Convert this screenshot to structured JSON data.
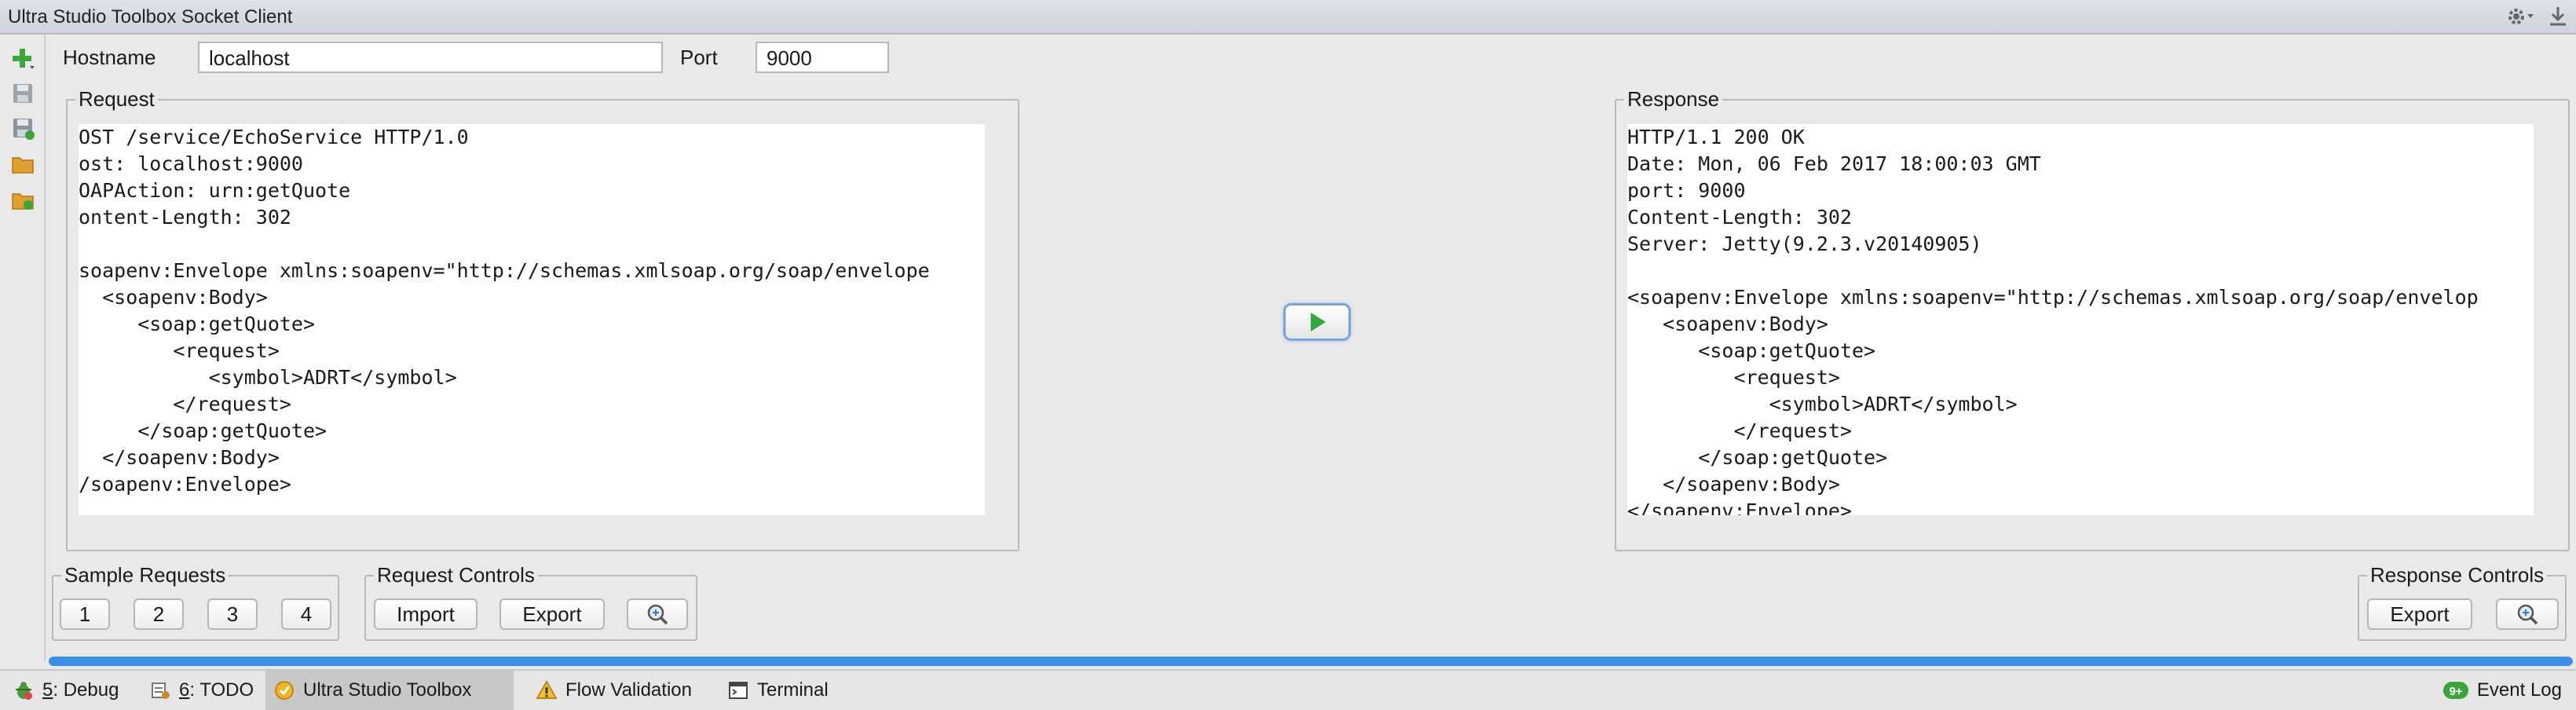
{
  "window": {
    "title": "Ultra Studio Toolbox Socket Client"
  },
  "toolbar_left": {
    "icons": [
      "add-icon",
      "save-icon",
      "save-as-icon",
      "open-folder-icon",
      "open-recent-icon"
    ]
  },
  "connection": {
    "hostname_label": "Hostname",
    "hostname_value": "localhost",
    "port_label": "Port",
    "port_value": "9000"
  },
  "request": {
    "legend": "Request",
    "lines": [
      "OST /service/EchoService HTTP/1.0",
      "ost: localhost:9000",
      "OAPAction: urn:getQuote",
      "ontent-Length: 302",
      "",
      "soapenv:Envelope xmlns:soapenv=\"http://schemas.xmlsoap.org/soap/envelope",
      "  <soapenv:Body>",
      "     <soap:getQuote>",
      "        <request>",
      "           <symbol>ADRT</symbol>",
      "        </request>",
      "     </soap:getQuote>",
      "  </soapenv:Body>",
      "/soapenv:Envelope>"
    ]
  },
  "response": {
    "legend": "Response",
    "lines": [
      "HTTP/1.1 200 OK",
      "Date: Mon, 06 Feb 2017 18:00:03 GMT",
      "port: 9000",
      "Content-Length: 302",
      "Server: Jetty(9.2.3.v20140905)",
      "",
      "<soapenv:Envelope xmlns:soapenv=\"http://schemas.xmlsoap.org/soap/envelop",
      "   <soapenv:Body>",
      "      <soap:getQuote>",
      "         <request>",
      "            <symbol>ADRT</symbol>",
      "         </request>",
      "      </soap:getQuote>",
      "   </soapenv:Body>",
      "</soapenv:Envelope>"
    ]
  },
  "sample_requests": {
    "legend": "Sample Requests",
    "buttons": [
      "1",
      "2",
      "3",
      "4"
    ]
  },
  "request_controls": {
    "legend": "Request Controls",
    "import_label": "Import",
    "export_label": "Export"
  },
  "response_controls": {
    "legend": "Response Controls",
    "export_label": "Export"
  },
  "progress": {
    "percent": 100,
    "color": "#3b8fe6"
  },
  "statusbar": {
    "debug": {
      "num": "5",
      "label": ": Debug"
    },
    "todo": {
      "num": "6",
      "label": ": TODO"
    },
    "toolbox": "Ultra Studio Toolbox",
    "flow_validation": "Flow Validation",
    "terminal": "Terminal",
    "event_log": "Event Log",
    "event_badge": "9+"
  }
}
